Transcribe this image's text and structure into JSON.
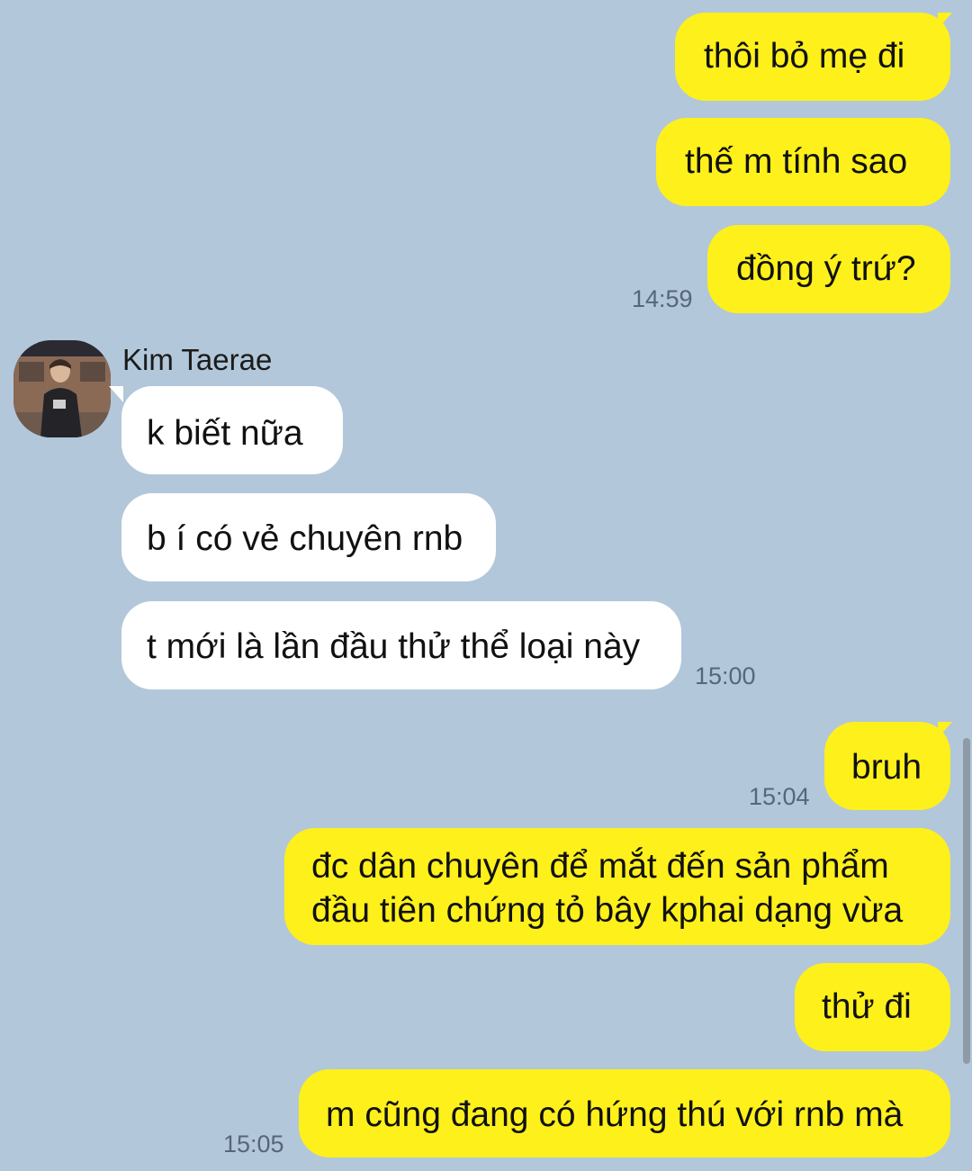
{
  "messages": {
    "out1": "thôi bỏ mẹ đi",
    "out2": "thế m tính sao",
    "out3": "đồng ý trứ?",
    "time1": "14:59",
    "sender_name": "Kim Taerae",
    "in1": "k biết nữa",
    "in2": "b í có vẻ chuyên rnb",
    "in3": "t mới là lần đầu thử thể loại này",
    "time2": "15:00",
    "out4": "bruh",
    "time3": "15:04",
    "out5_line1": "đc dân chuyên để mắt đến sản phẩm",
    "out5_line2": "đầu tiên chứng tỏ bây kphai dạng vừa",
    "out6": "thử đi",
    "out7": "m cũng đang có hứng thú với rnb mà",
    "time4": "15:05"
  },
  "colors": {
    "background": "#b2c7da",
    "outgoing_bubble": "#fef01b",
    "incoming_bubble": "#ffffff",
    "timestamp": "#566778"
  },
  "icons": {
    "avatar": "profile-photo-avatar"
  }
}
